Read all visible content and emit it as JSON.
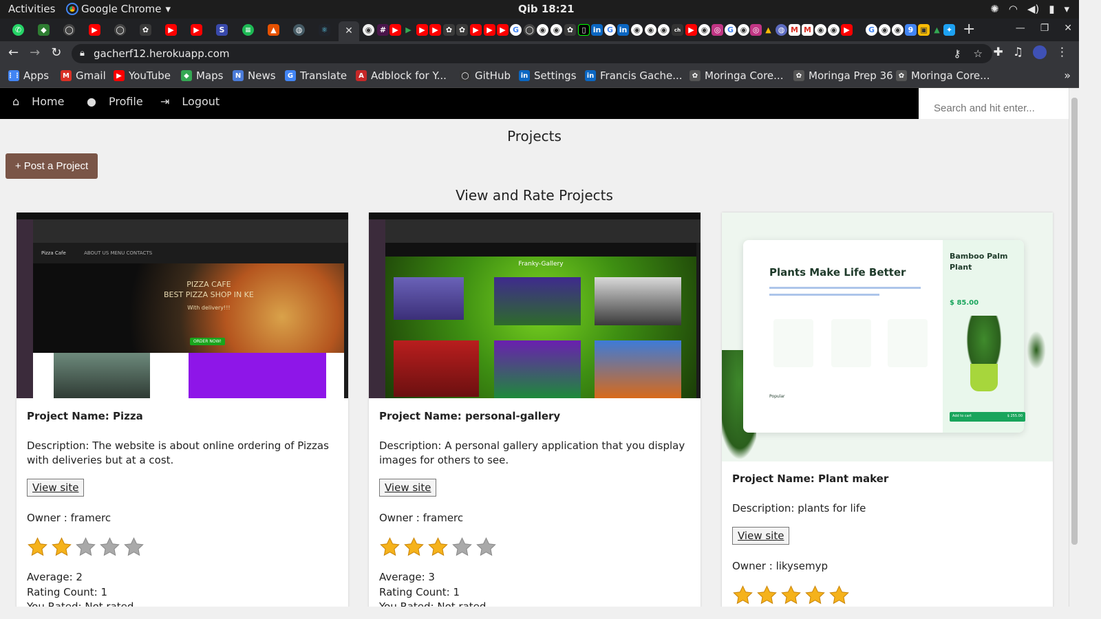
{
  "os": {
    "activities": "Activities",
    "app_name": "Google Chrome",
    "clock": "Qib 18:21"
  },
  "browser": {
    "url": "gacherf12.herokuapp.com",
    "bookmarks": [
      {
        "label": "Apps",
        "color": "#4285f4",
        "glyph": "⋮⋮"
      },
      {
        "label": "Gmail",
        "color": "#d93025",
        "glyph": "M"
      },
      {
        "label": "YouTube",
        "color": "#ff0000",
        "glyph": "▶"
      },
      {
        "label": "Maps",
        "color": "#34a853",
        "glyph": "◆"
      },
      {
        "label": "News",
        "color": "#4a7bd9",
        "glyph": "N"
      },
      {
        "label": "Translate",
        "color": "#4285f4",
        "glyph": "G"
      },
      {
        "label": "Adblock for Y...",
        "color": "#c62828",
        "glyph": "A"
      },
      {
        "label": "GitHub",
        "color": "#333333",
        "glyph": "◯"
      },
      {
        "label": "Settings",
        "color": "#0a66c2",
        "glyph": "in"
      },
      {
        "label": "Francis Gache...",
        "color": "#0a66c2",
        "glyph": "in"
      },
      {
        "label": "Moringa Core...",
        "color": "#555555",
        "glyph": "✿"
      },
      {
        "label": "Moringa Prep 36",
        "color": "#555555",
        "glyph": "✿"
      },
      {
        "label": "Moringa Core...",
        "color": "#555555",
        "glyph": "✿"
      }
    ]
  },
  "site": {
    "nav": {
      "home": "Home",
      "profile": "Profile",
      "logout": "Logout",
      "search_placeholder": "Search and hit enter..."
    },
    "page_title": "Projects",
    "post_button": "+ Post a Project",
    "subtitle": "View and Rate Projects",
    "projects": [
      {
        "name": "Project Name: Pizza",
        "description": "Description: The website is about online ordering of Pizzas with deliveries but at a cost.",
        "view_label": "View site",
        "owner": "Owner : framerc",
        "rating": 2,
        "average": "Average: 2",
        "count": "Rating Count: 1",
        "you_rated": "You Rated: Not rated",
        "thumb": {
          "site_brand": "Pizza Cafe",
          "site_nav": "ABOUT US   MENU   CONTACTS",
          "hero_title": "PIZZA CAFE",
          "hero_sub": "BEST PIZZA SHOP IN KE",
          "hero_small": "With delivery!!!",
          "cta": "ORDER NOW!"
        }
      },
      {
        "name": "Project Name: personal-gallery",
        "description": "Description: A personal gallery application that you display images for others to see.",
        "view_label": "View site",
        "owner": "Owner : framerc",
        "rating": 3,
        "average": "Average: 3",
        "count": "Rating Count: 1",
        "you_rated": "You Rated: Not rated",
        "thumb": {
          "gallery_title": "Franky-Gallery"
        }
      },
      {
        "name": "Project Name: Plant maker",
        "description": "Description: plants for life",
        "view_label": "View site",
        "owner": "Owner : likysemyp",
        "rating": 5,
        "thumb": {
          "headline": "Plants Make Life Better",
          "product": "Bamboo Palm Plant",
          "price": "$ 85.00",
          "popular": "Popular",
          "add_to_cart": "Add to cart",
          "total": "$ 255.00"
        }
      }
    ]
  }
}
